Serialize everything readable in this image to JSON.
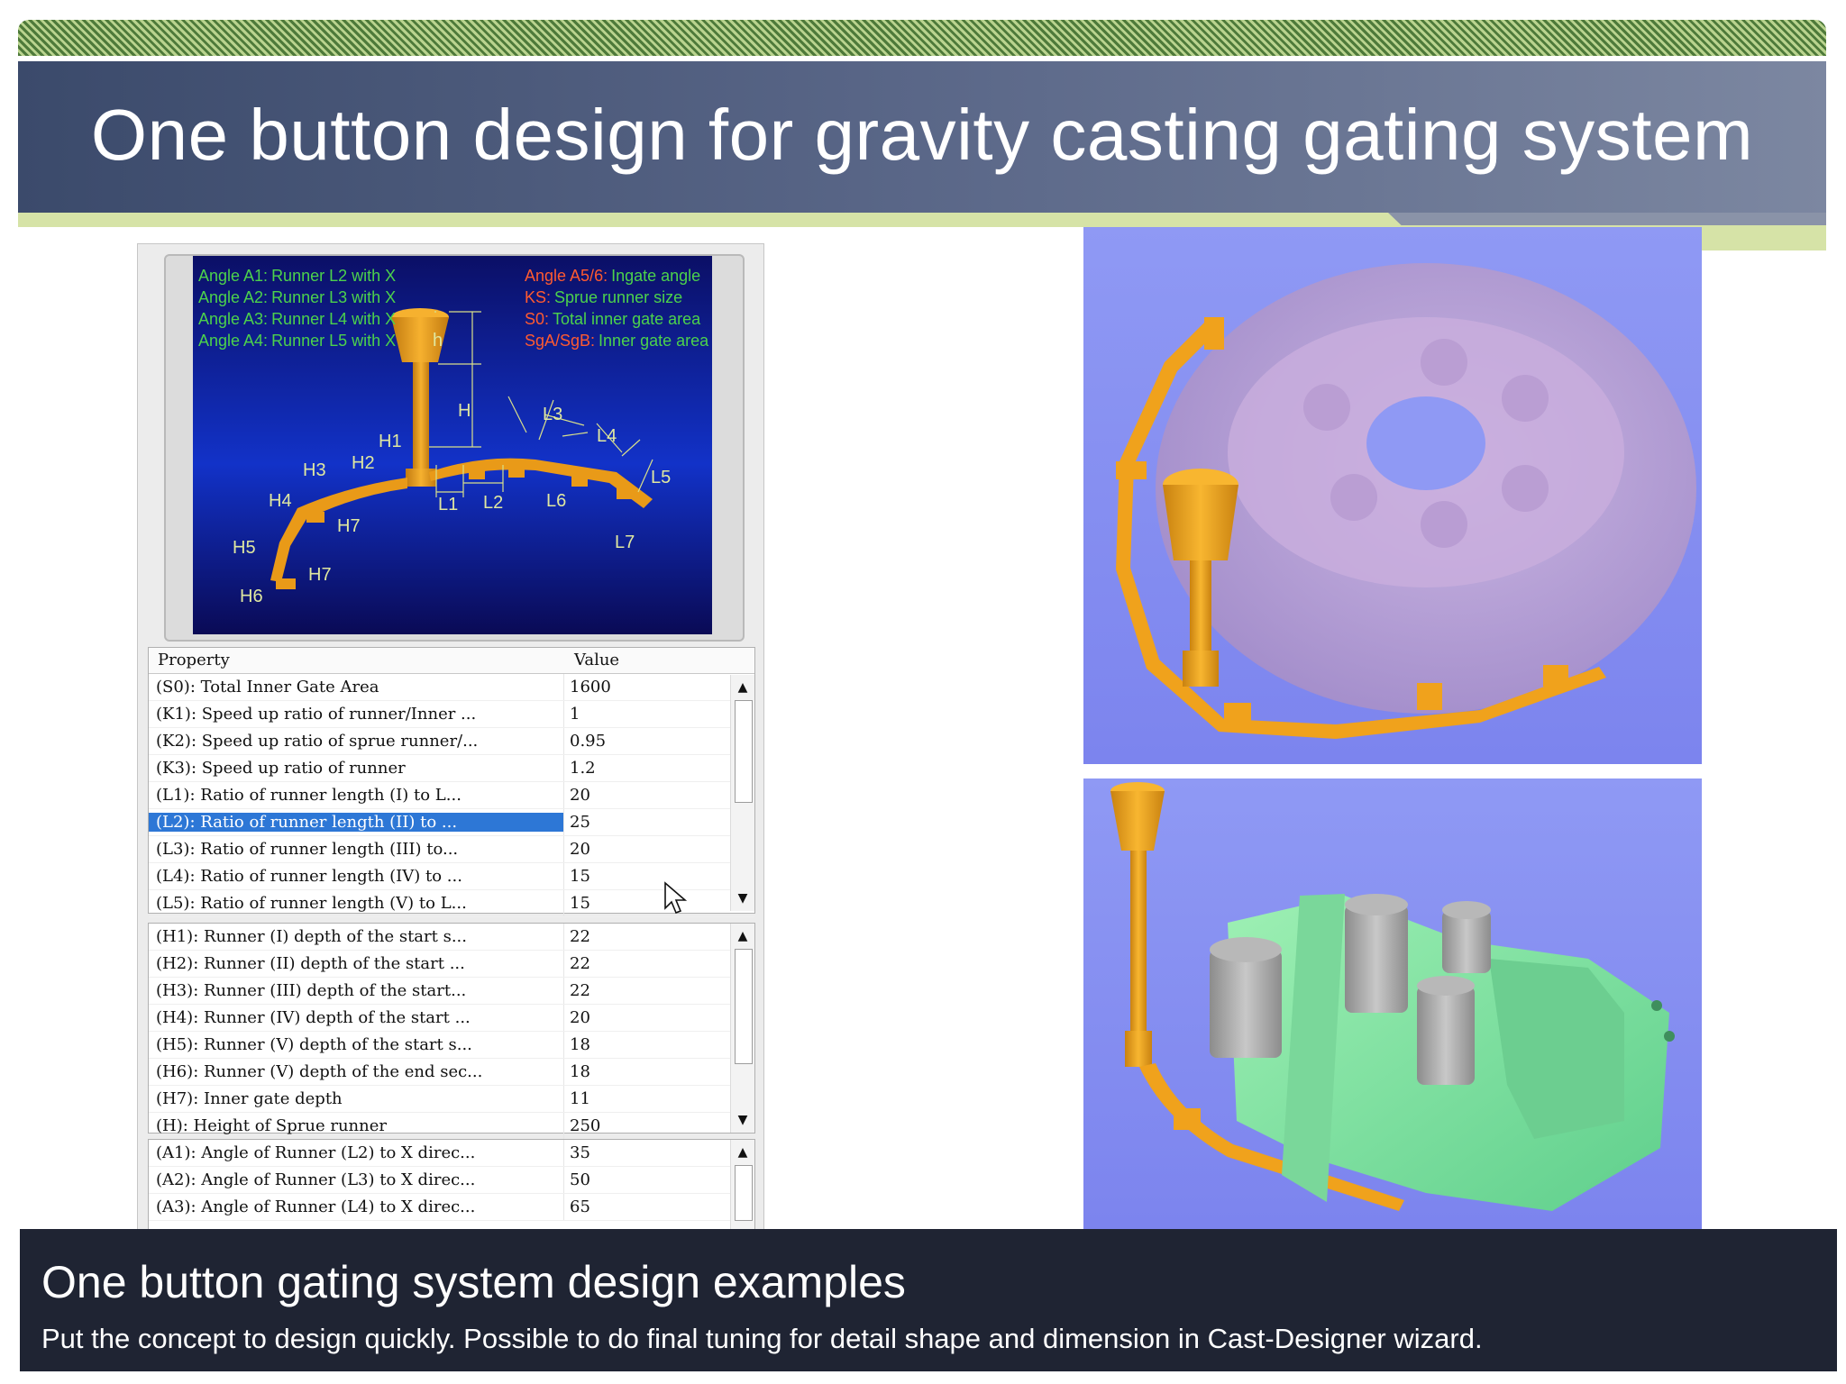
{
  "slide": {
    "title": "One button design for gravity casting gating system",
    "caption_title": "One button gating system design examples",
    "caption_text": "Put the concept to design quickly. Possible to do final tuning for detail shape and dimension in Cast-Designer wizard."
  },
  "diagram": {
    "legend_left": [
      {
        "key": "Angle A1:",
        "text": "Runner L2 with X"
      },
      {
        "key": "Angle A2:",
        "text": "Runner L3 with X"
      },
      {
        "key": "Angle A3:",
        "text": "Runner L4 with X"
      },
      {
        "key": "Angle A4:",
        "text": "Runner L5 with X"
      }
    ],
    "legend_right": [
      {
        "key": "Angle A5/6:",
        "text": "Ingate angle"
      },
      {
        "key": "KS:",
        "text": "Sprue runner size"
      },
      {
        "key": "S0:",
        "text": "Total inner gate area"
      },
      {
        "key": "SgA/SgB:",
        "text": "Inner gate area"
      }
    ],
    "labels": [
      "h",
      "H",
      "H1",
      "H2",
      "H3",
      "H4",
      "H5",
      "H6",
      "H7",
      "H7",
      "L1",
      "L2",
      "L3",
      "L4",
      "L5",
      "L6",
      "L7"
    ]
  },
  "table": {
    "header_property": "Property",
    "header_value": "Value",
    "group1": [
      {
        "p": "(S0): Total Inner Gate Area",
        "v": "1600"
      },
      {
        "p": "(K1): Speed up ratio of runner/Inner ...",
        "v": "1"
      },
      {
        "p": "(K2): Speed up ratio of sprue runner/...",
        "v": "0.95"
      },
      {
        "p": "(K3): Speed up ratio of runner",
        "v": "1.2"
      },
      {
        "p": "(L1): Ratio of runner length (I) to L...",
        "v": "20"
      },
      {
        "p": "(L2): Ratio of runner length (II) to ...",
        "v": "25"
      },
      {
        "p": "(L3): Ratio of runner length (III) to...",
        "v": "20"
      },
      {
        "p": "(L4): Ratio of runner length (IV) to ...",
        "v": "15"
      },
      {
        "p": "(L5): Ratio of runner length (V) to L...",
        "v": "15"
      }
    ],
    "group2": [
      {
        "p": "(H1): Runner (I) depth of the start s...",
        "v": "22"
      },
      {
        "p": "(H2): Runner (II) depth of the start ...",
        "v": "22"
      },
      {
        "p": "(H3): Runner (III) depth of the start...",
        "v": "22"
      },
      {
        "p": "(H4): Runner (IV) depth of the start ...",
        "v": "20"
      },
      {
        "p": "(H5): Runner (V) depth of the start s...",
        "v": "18"
      },
      {
        "p": "(H6): Runner (V) depth of the end sec...",
        "v": "18"
      },
      {
        "p": "(H7): Inner gate depth",
        "v": "11"
      },
      {
        "p": "(H): Height of Sprue runner",
        "v": "250"
      }
    ],
    "group3": [
      {
        "p": "(A1): Angle of Runner (L2) to X direc...",
        "v": "35"
      },
      {
        "p": "(A2): Angle of Runner (L3) to X direc...",
        "v": "50"
      },
      {
        "p": "(A3): Angle of Runner (L4) to X direc...",
        "v": "65"
      }
    ],
    "selected_row": 5
  },
  "colors": {
    "runner": "#f0a21c",
    "diagram_bg": "#0a1a8a",
    "legend_green": "#4cd24c",
    "legend_red": "#ff4a2a",
    "viewport_bg": "#8f99f4",
    "selection": "#2d77d6",
    "caption_bg": "#1f2433"
  },
  "icons": {
    "scroll_up": "▲",
    "scroll_down": "▼"
  }
}
